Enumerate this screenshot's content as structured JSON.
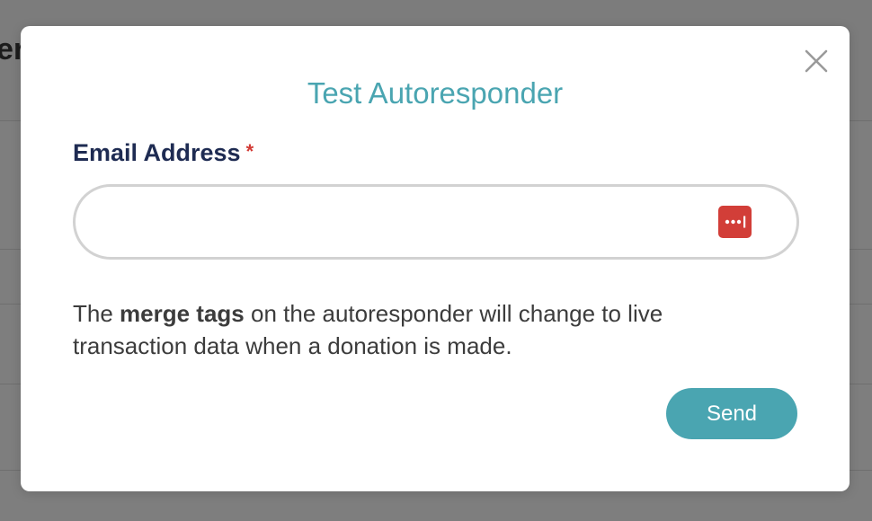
{
  "background": {
    "heading_fragment": "er"
  },
  "modal": {
    "title": "Test Autoresponder",
    "email_field": {
      "label": "Email Address",
      "required_marker": "*",
      "value": "",
      "placeholder": ""
    },
    "info_text": {
      "before": "The ",
      "bold": "merge tags",
      "after": " on the autoresponder will change to live transaction data when a donation is made."
    },
    "send_label": "Send",
    "icons": {
      "close": "close-icon",
      "password_manager": "password-manager-icon"
    }
  },
  "colors": {
    "accent": "#4aa5b1",
    "label": "#1e2b52",
    "required": "#d23a34",
    "password_manager": "#d23e38",
    "overlay": "#7e7e7e"
  }
}
